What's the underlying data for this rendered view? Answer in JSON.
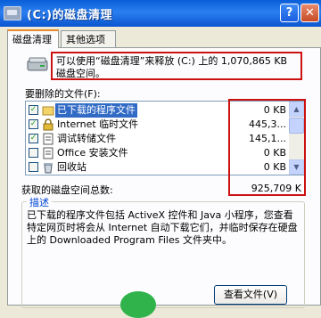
{
  "window": {
    "title": "(C:)的磁盘清理",
    "help": "?",
    "close": "✕"
  },
  "tabs": [
    "磁盘清理",
    "其他选项"
  ],
  "info_text": "可以使用“磁盘清理”来释放 (C:) 上的 1,070,865 KB 磁盘空间。",
  "list_label": "要删除的文件(F):",
  "files": [
    {
      "checked": true,
      "name": "已下载的程序文件",
      "size": "0 KB",
      "selected": true
    },
    {
      "checked": true,
      "name": "Internet 临时文件",
      "size": "445,3..."
    },
    {
      "checked": true,
      "name": "调试转储文件",
      "size": "145,1..."
    },
    {
      "checked": false,
      "name": "Office 安装文件",
      "size": "0 KB"
    },
    {
      "checked": false,
      "name": "回收站",
      "size": "0 KB"
    }
  ],
  "total_label": "获取的磁盘空间总数:",
  "total_value": "925,709 K",
  "desc_legend": "描述",
  "description": "已下载的程序文件包括 ActiveX 控件和 Java 小程序，您查看特定网页时将会从 Internet 自动下载它们，并临时保存在硬盘上的 Downloaded Program Files 文件夹中。",
  "view_files_button": "查看文件(V)",
  "colors": {
    "titlebar": "#0a5fd8",
    "highlight": "#316ac5",
    "annotation": "#cc1111"
  }
}
